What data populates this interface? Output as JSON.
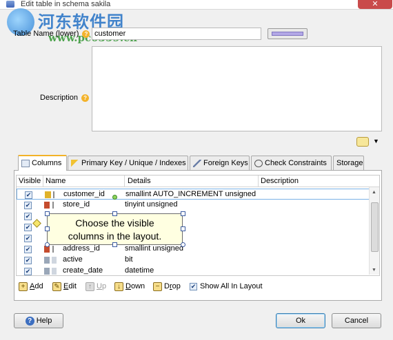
{
  "window": {
    "title": "Edit table in schema sakila",
    "close_label": "✕"
  },
  "watermark": {
    "cn_text": "河东软件园",
    "url": "www.pc0359.cn"
  },
  "form": {
    "name_label": "Table Name (lower)",
    "name_value": "customer",
    "description_label": "Description",
    "help_glyph": "?",
    "color_swatch": "#b3a8e6"
  },
  "tabs": [
    {
      "label": "Columns",
      "icon": "columns-icon"
    },
    {
      "label": "Primary Key / Unique / Indexes",
      "icon": "key-icon"
    },
    {
      "label": "Foreign Keys",
      "icon": "foreign-key-icon"
    },
    {
      "label": "Check Constraints",
      "icon": "check-constraint-icon"
    },
    {
      "label": "Storage",
      "icon": ""
    }
  ],
  "grid": {
    "headers": [
      "Visible",
      "Name",
      "Details",
      "Description"
    ],
    "rows": [
      {
        "visible": true,
        "name": "customer_id",
        "details": "smallint AUTO_INCREMENT unsigned",
        "description": ""
      },
      {
        "visible": true,
        "name": "store_id",
        "details": "tinyint unsigned",
        "description": ""
      },
      {
        "visible": true,
        "name": "",
        "details": "",
        "description": ""
      },
      {
        "visible": true,
        "name": "",
        "details": "",
        "description": ""
      },
      {
        "visible": true,
        "name": "",
        "details": "",
        "description": ""
      },
      {
        "visible": true,
        "name": "address_id",
        "details": "smallint unsigned",
        "description": ""
      },
      {
        "visible": true,
        "name": "active",
        "details": "bit",
        "description": ""
      },
      {
        "visible": true,
        "name": "create_date",
        "details": "datetime",
        "description": ""
      }
    ],
    "check_glyph": "✔"
  },
  "tooltip": {
    "line1": "Choose the visible",
    "line2": "columns in the layout."
  },
  "toolbar": {
    "add": {
      "pre": "",
      "ul": "A",
      "post": "dd"
    },
    "edit": {
      "pre": "",
      "ul": "E",
      "post": "dit"
    },
    "up": {
      "pre": "",
      "ul": "U",
      "post": "p"
    },
    "down": {
      "pre": "",
      "ul": "D",
      "post": "own"
    },
    "drop": {
      "pre": "D",
      "ul": "r",
      "post": "op"
    },
    "show_all": "Show All In Layout"
  },
  "buttons": {
    "help": "Help",
    "ok": "Ok",
    "cancel": "Cancel"
  }
}
